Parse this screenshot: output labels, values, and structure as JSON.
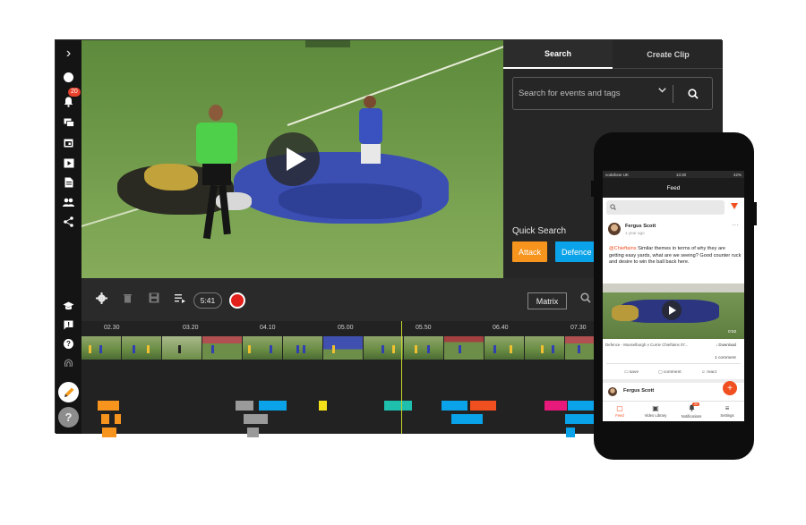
{
  "sidebar": {
    "items": [
      {
        "icon": "chevron-right-icon",
        "glyph": "›"
      },
      {
        "icon": "rugby-ball-icon",
        "glyph": "●"
      },
      {
        "icon": "bell-icon",
        "glyph": "🔔",
        "badge": "20"
      },
      {
        "icon": "chat-icon",
        "glyph": "▣"
      },
      {
        "icon": "calendar-icon",
        "glyph": "▦"
      },
      {
        "icon": "video-library-icon",
        "glyph": "▶"
      },
      {
        "icon": "document-icon",
        "glyph": "▤"
      },
      {
        "icon": "people-icon",
        "glyph": "👥"
      },
      {
        "icon": "share-icon",
        "glyph": "⋖"
      },
      {
        "icon": "graduation-cap-icon",
        "glyph": "🎓"
      },
      {
        "icon": "feedback-icon",
        "glyph": "!"
      },
      {
        "icon": "help-icon",
        "glyph": "?"
      },
      {
        "icon": "fingerprint-icon",
        "glyph": "◎"
      }
    ]
  },
  "search_panel": {
    "tab_search": "Search",
    "tab_create_clip": "Create Clip",
    "search_placeholder": "Search for events and tags",
    "quick_search_label": "Quick Search",
    "quick_buttons": [
      {
        "label": "Attack",
        "color": "#f7941d"
      },
      {
        "label": "Defence",
        "color": "#0aa2e8"
      }
    ]
  },
  "toolbar": {
    "time": "5:41",
    "matrix_label": "Matrix"
  },
  "timeline": {
    "ticks": [
      "02.30",
      "03.20",
      "04.10",
      "05.00",
      "05.50",
      "06.40",
      "07.30"
    ],
    "playhead_label": ""
  },
  "phone": {
    "status_left": "vodafone UK",
    "status_time": "13:30",
    "status_right": "42%",
    "header_title": "Feed",
    "post_author": "Fergus Scott",
    "post_time": "1 year ago",
    "post_mention": "@Chieftains",
    "post_text": " Similar themes in terms of why they are getting easy yards, what are we seeing? Good counter ruck and desire to win the ball back here.",
    "video_duration": "0:52",
    "video_caption": "Defence - Musselburgh v Currie Chieftains 07...",
    "download_label": "Download",
    "comment_count": "1 comment",
    "action_save": "save",
    "action_comment": "comment",
    "action_react": "react",
    "second_author": "Fergus Scott",
    "nav": [
      {
        "label": "Feed",
        "icon": "feed-icon",
        "glyph": "▢"
      },
      {
        "label": "Video Library",
        "icon": "video-library-icon",
        "glyph": "▣"
      },
      {
        "label": "Notifications",
        "icon": "bell-icon",
        "glyph": "🔔",
        "badge": "20"
      },
      {
        "label": "Settings",
        "icon": "menu-icon",
        "glyph": "≡"
      }
    ],
    "accent": "#f04f1f"
  }
}
